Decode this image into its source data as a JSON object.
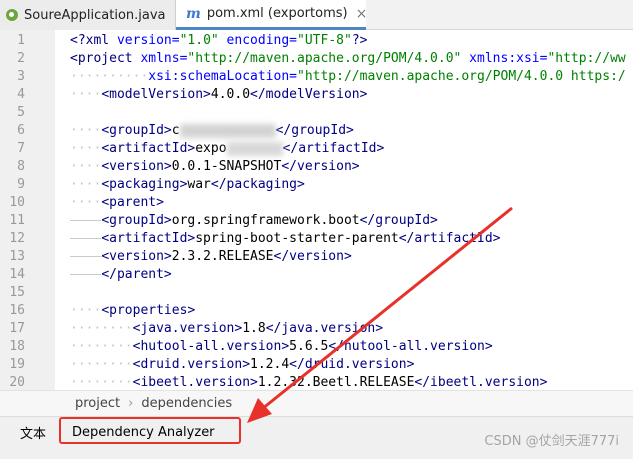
{
  "tabs": [
    {
      "label": "SoureApplication.java",
      "icon": "spring-class-icon"
    },
    {
      "label": "pom.xml (exportoms)",
      "icon": "maven-m-icon",
      "active": true
    }
  ],
  "line_numbers": [
    "1",
    "2",
    "3",
    "4",
    "5",
    "6",
    "7",
    "8",
    "9",
    "10",
    "11",
    "12",
    "13",
    "14",
    "15",
    "16",
    "17",
    "18",
    "19",
    "20"
  ],
  "code": {
    "l1": {
      "a": "<?",
      "b": "xml",
      "c": " version=",
      "d": "\"1.0\"",
      "e": " encoding=",
      "f": "\"UTF-8\"",
      "g": "?>"
    },
    "l2": {
      "a": "<project",
      "b": " xmlns=",
      "c": "\"http://maven.apache.org/POM/4.0.0\"",
      "d": " xmlns:xsi=",
      "e": "\"http://ww"
    },
    "l3": {
      "ws": "··········",
      "a": "xsi:schemaLocation=",
      "b": "\"http://maven.apache.org/POM/4.0.0 https:/"
    },
    "l4": {
      "ws": "····",
      "o": "<modelVersion>",
      "v": "4.0.0",
      "c": "</modelVersion>"
    },
    "l6": {
      "ws": "····",
      "o": "<groupId>",
      "pre": "c",
      "c": "</groupId>"
    },
    "l7": {
      "ws": "····",
      "o": "<artifactId>",
      "v": "expo",
      "c": "</artifactId>"
    },
    "l8": {
      "ws": "····",
      "o": "<version>",
      "v": "0.0.1-SNAPSHOT",
      "c": "</version>"
    },
    "l9": {
      "ws": "····",
      "o": "<packaging>",
      "v": "war",
      "c": "</packaging>"
    },
    "l10": {
      "ws": "····",
      "o": "<parent>"
    },
    "l11": {
      "ws": "————",
      "o": "<groupId>",
      "v": "org.springframework.boot",
      "c": "</groupId>"
    },
    "l12": {
      "ws": "————",
      "o": "<artifactId>",
      "v": "spring-boot-starter-parent",
      "c": "</artifactId>"
    },
    "l13": {
      "ws": "————",
      "o": "<version>",
      "v": "2.3.2.RELEASE",
      "c": "</version>"
    },
    "l14": {
      "ws": "————",
      "o": "</parent>"
    },
    "l16": {
      "ws": "····",
      "o": "<properties>"
    },
    "l17": {
      "ws": "········",
      "o": "<java.version>",
      "v": "1.8",
      "c": "</java.version>"
    },
    "l18": {
      "ws": "········",
      "o": "<hutool-all.version>",
      "v": "5.6.5",
      "c": "</hutool-all.version>"
    },
    "l19": {
      "ws": "········",
      "o": "<druid.version>",
      "v": "1.2.4",
      "c": "</druid.version>"
    },
    "l20": {
      "ws": "········",
      "o": "<ibeetl.version>",
      "v": "1.2.32.Beetl.RELEASE",
      "c": "</ibeetl.version>"
    }
  },
  "breadcrumb": [
    "project",
    "dependencies"
  ],
  "bottom_tabs": [
    "文本",
    "Dependency Analyzer"
  ],
  "watermark": "CSDN @仗剑天涯777i",
  "colors": {
    "tag": "#000080",
    "attr": "#0000ff",
    "string": "#008000",
    "highlight": "#e8312a",
    "active_tab": "#4a86c5"
  }
}
